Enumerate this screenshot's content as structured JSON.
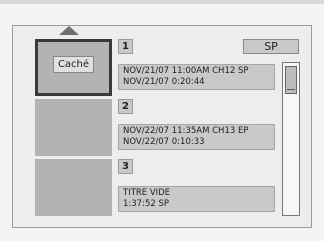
{
  "header": {
    "mode": "SP"
  },
  "titles": [
    {
      "number": "1",
      "selected": true,
      "thumbnail_label": "Caché",
      "line1": "NOV/21/07  11:00AM CH12  SP",
      "line2": "NOV/21/07    0:20:44"
    },
    {
      "number": "2",
      "selected": false,
      "thumbnail_label": "",
      "line1": "NOV/22/07  11:35AM CH13  EP",
      "line2": "NOV/22/07    0:10:33"
    },
    {
      "number": "3",
      "selected": false,
      "thumbnail_label": "",
      "line1": "TITRE VIDE",
      "line2": "1:37:52  SP"
    }
  ],
  "icons": {
    "scroll_up": "up-arrow-icon"
  },
  "colors": {
    "background": "#f4f4f4",
    "panel": "#ededed",
    "thumbnail": "#b3b3b3",
    "info_box": "#c9c9c9",
    "selection_border": "#3a3a3a"
  }
}
